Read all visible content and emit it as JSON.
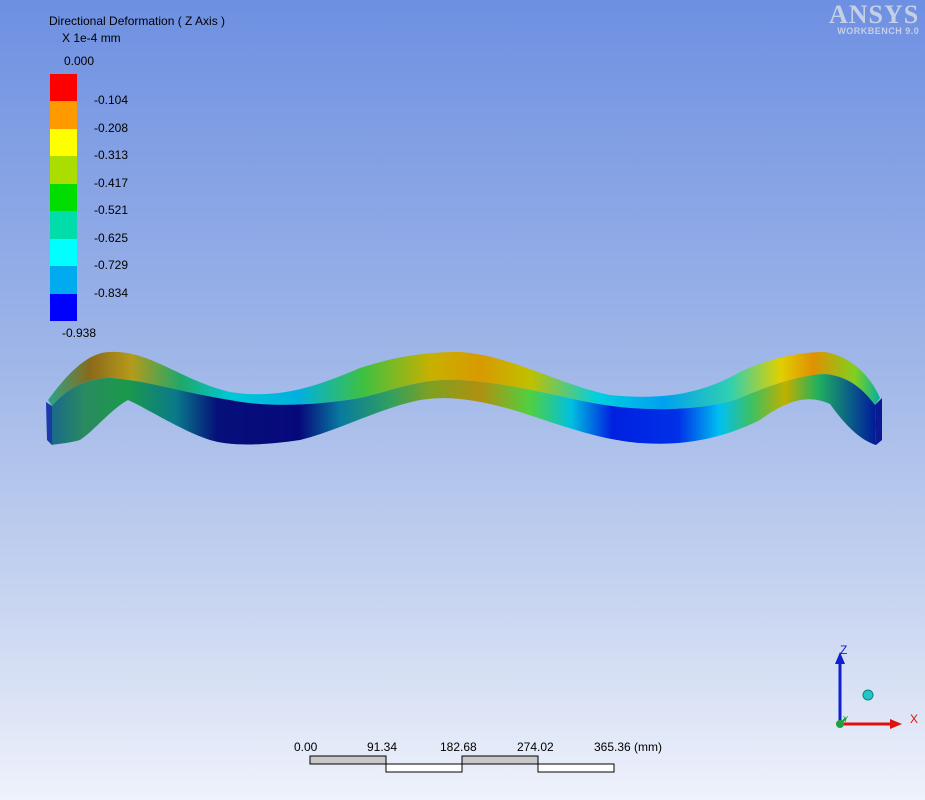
{
  "result": {
    "title": "Directional Deformation ( Z Axis )",
    "units": "X 1e-4 mm",
    "max_label": "0.000",
    "min_label": "-0.938"
  },
  "legend": {
    "ticks": [
      "-0.104",
      "-0.208",
      "-0.313",
      "-0.417",
      "-0.521",
      "-0.625",
      "-0.729",
      "-0.834"
    ],
    "colors": [
      "#ff0000",
      "#ff9900",
      "#ffff00",
      "#aadd00",
      "#00dd00",
      "#00ddaa",
      "#00ffff",
      "#00aaee",
      "#0000ff"
    ]
  },
  "logo": {
    "brand": "ANSYS",
    "product": "WORKBENCH 9.0"
  },
  "triad": {
    "z_label": "Z",
    "x_label": "X",
    "y_label": "Y"
  },
  "scale_bar": {
    "labels": [
      "0.00",
      "91.34",
      "182.68",
      "274.02",
      "365.36 (mm)"
    ]
  }
}
